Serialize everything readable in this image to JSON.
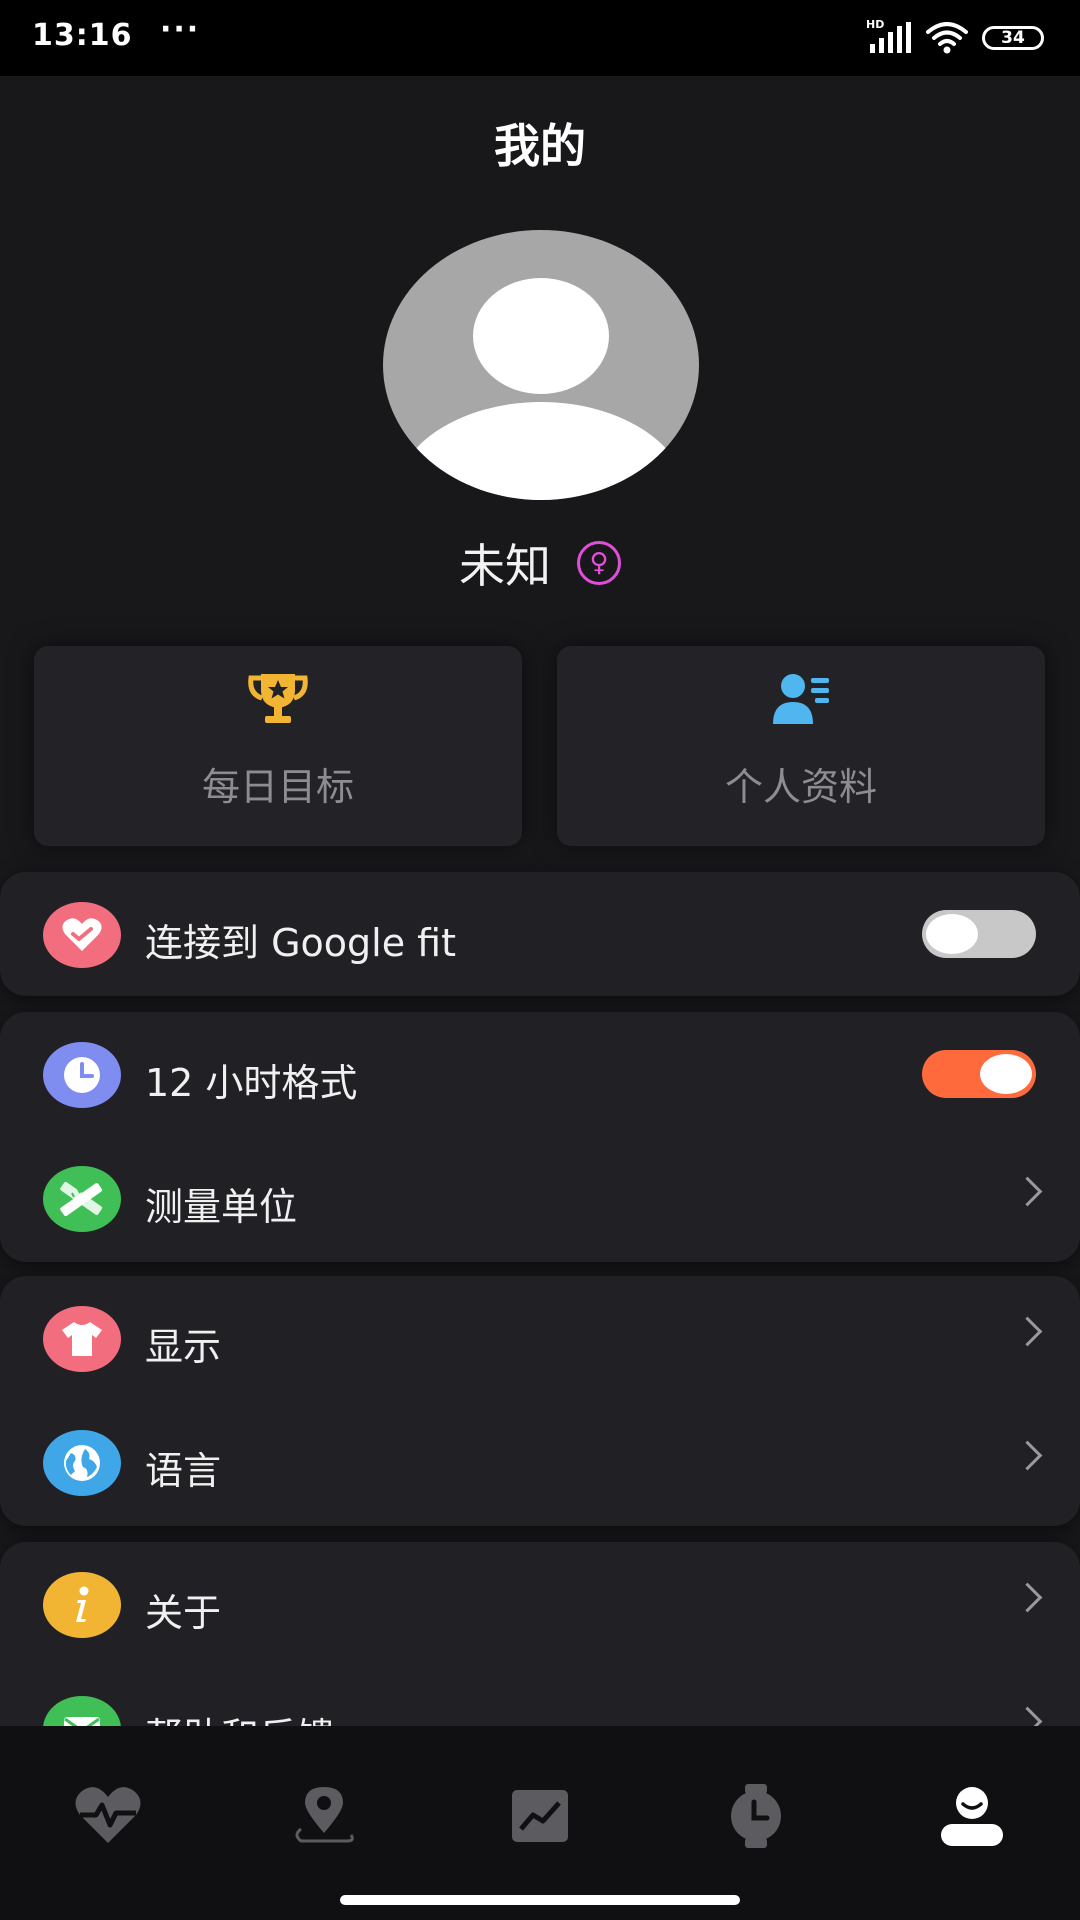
{
  "status_bar": {
    "time": "13:16",
    "dots": "···",
    "network": "HD",
    "battery": "34"
  },
  "header": {
    "title": "我的"
  },
  "profile": {
    "name": "未知",
    "gender_symbol": "♀"
  },
  "cards": [
    {
      "label": "每日目标",
      "icon": "trophy-icon"
    },
    {
      "label": "个人资料",
      "icon": "profile-card-icon"
    }
  ],
  "settings": {
    "google_fit": {
      "label": "连接到 Google fit",
      "enabled": false
    },
    "time_format": {
      "label": "12 小时格式",
      "enabled": true
    },
    "units": {
      "label": "测量单位"
    },
    "display": {
      "label": "显示"
    },
    "language": {
      "label": "语言"
    },
    "about": {
      "label": "关于"
    },
    "help": {
      "label": "帮助和反馈"
    }
  },
  "bottom_nav": [
    {
      "icon": "heart-pulse-icon",
      "active": false
    },
    {
      "icon": "map-pin-icon",
      "active": false
    },
    {
      "icon": "chart-icon",
      "active": false
    },
    {
      "icon": "watch-icon",
      "active": false
    },
    {
      "icon": "user-icon",
      "active": true
    }
  ],
  "colors": {
    "background": "#18181b",
    "card": "#232327",
    "toggle_on": "#ff6a3d",
    "toggle_off": "#c8c8c8",
    "gender": "#e04fd9",
    "google_fit_icon": "#f26d7d",
    "clock_icon": "#7f8cf0",
    "ruler_icon": "#3fbf55",
    "display_icon": "#f26d7d",
    "language_icon": "#3fa6e8",
    "about_icon": "#f2b533",
    "help_icon": "#3fbf55"
  }
}
